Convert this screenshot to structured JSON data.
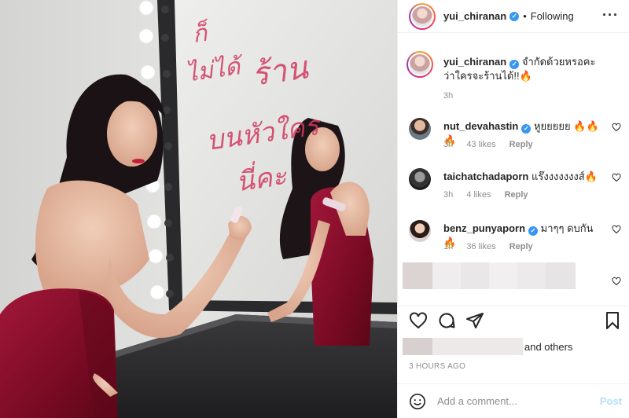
{
  "post": {
    "username": "yui_chiranan",
    "follow_label": "Following",
    "caption": "จำกัดด้วยหรอคะ ว่าใครจะร้านได้!!🔥",
    "caption_time": "3h"
  },
  "photo": {
    "handwriting": [
      "ก็",
      "ไม่ได้",
      "ร้าน",
      "บนหัวใคร",
      "นี่คะ"
    ]
  },
  "comments": [
    {
      "user": "nut_devahastin",
      "verified": true,
      "text": "หูยยยยย 🔥🔥🔥",
      "time": "3h",
      "likes": "43 likes",
      "reply": "Reply"
    },
    {
      "user": "taichatchadaporn",
      "verified": false,
      "text": "แร๊งงงงงงงส์🔥",
      "time": "3h",
      "likes": "4 likes",
      "reply": "Reply"
    },
    {
      "user": "benz_punyaporn",
      "verified": true,
      "text": "มาๆๆ ดบกัน 🔥",
      "time": "1h",
      "likes": "36 likes",
      "reply": "Reply"
    }
  ],
  "likes_text": "and others",
  "timestamp": "3 HOURS AGO",
  "add_comment_placeholder": "Add a comment...",
  "post_button": "Post",
  "icons": {
    "more": "more-options-icon",
    "like": "heart-icon",
    "comment": "comment-icon",
    "share": "share-icon",
    "save": "bookmark-icon",
    "emoji": "emoji-icon",
    "verified": "verified-badge-icon"
  },
  "colors": {
    "accent": "#3897f0",
    "post_disabled": "#b2dffc",
    "muted": "#8e8e8e",
    "dress": "#8b0f2a"
  }
}
